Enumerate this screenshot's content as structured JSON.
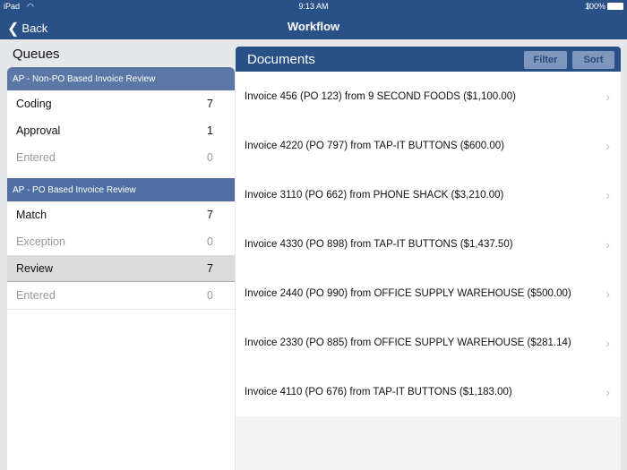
{
  "status": {
    "device": "iPad",
    "time": "9:13 AM",
    "battery": "100%"
  },
  "nav": {
    "back": "Back",
    "title": "Workflow"
  },
  "queues": {
    "title": "Queues",
    "groups": [
      {
        "name": "AP - Non-PO Based Invoice Review",
        "items": [
          {
            "label": "Coding",
            "count": "7"
          },
          {
            "label": "Approval",
            "count": "1"
          },
          {
            "label": "Entered",
            "count": "0"
          }
        ]
      },
      {
        "name": "AP - PO Based Invoice Review",
        "items": [
          {
            "label": "Match",
            "count": "7"
          },
          {
            "label": "Exception",
            "count": "0"
          },
          {
            "label": "Review",
            "count": "7"
          },
          {
            "label": "Entered",
            "count": "0"
          }
        ]
      }
    ]
  },
  "documents": {
    "title": "Documents",
    "filter": "Filter",
    "sort": "Sort",
    "items": [
      "Invoice 456 (PO 123) from 9 SECOND FOODS ($1,100.00)",
      "Invoice 4220 (PO 797) from TAP-IT BUTTONS ($600.00)",
      "Invoice 3110 (PO 662) from PHONE SHACK ($3,210.00)",
      "Invoice 4330 (PO 898) from TAP-IT BUTTONS ($1,437.50)",
      "Invoice 2440 (PO 990) from OFFICE SUPPLY WAREHOUSE ($500.00)",
      "Invoice 2330 (PO 885) from OFFICE SUPPLY WAREHOUSE ($281.14)",
      "Invoice 4110 (PO 676) from TAP-IT BUTTONS ($1,183.00)"
    ]
  }
}
